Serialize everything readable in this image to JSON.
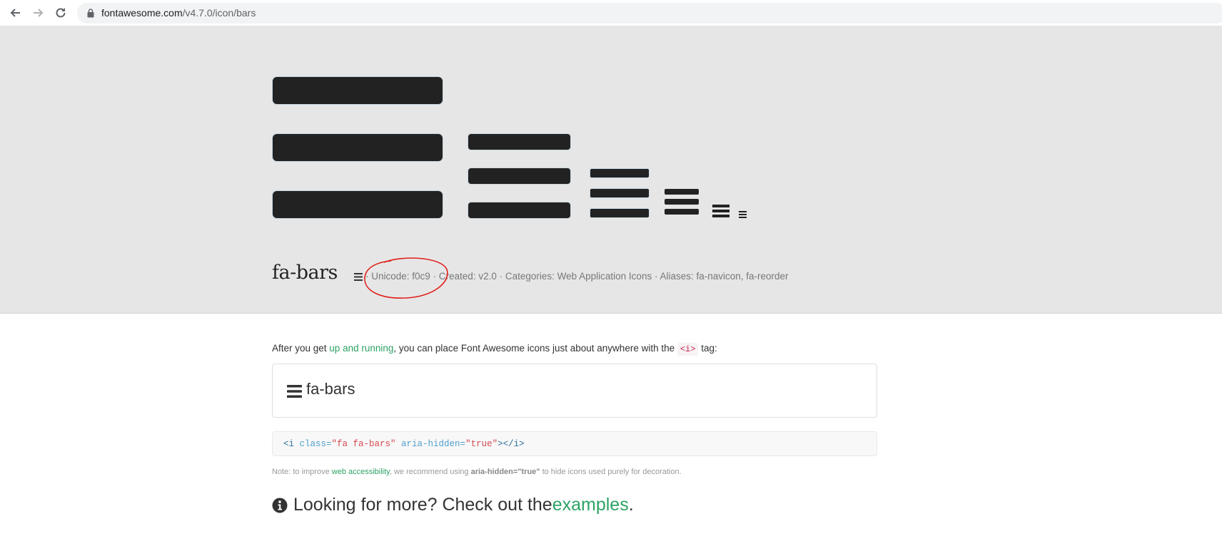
{
  "browser": {
    "url_host": "fontawesome.com",
    "url_path": "/v4.7.0/icon/bars",
    "icons": [
      "back-arrow-icon",
      "forward-arrow-icon",
      "reload-icon",
      "lock-icon"
    ]
  },
  "hero": {
    "title": "fa-bars",
    "meta": "· Unicode: f0c9 · Created: v2.0 · Categories: Web Application Icons · Aliases: fa-navicon, fa-reorder",
    "icon": "bars-icon",
    "annotation_color": "#e0201c"
  },
  "content": {
    "intro_before": "After you get ",
    "intro_link": "up and running",
    "intro_middle": ", you can place Font Awesome icons just about anywhere with the ",
    "intro_code": "<i>",
    "intro_after": " tag:",
    "example_label": "fa-bars",
    "code_parts": {
      "open": "<i ",
      "class_attr": "class=",
      "class_val": "\"fa fa-bars\"",
      "aria_attr": " aria-hidden=",
      "aria_val": "\"true\"",
      "close": "></i>"
    },
    "note_before": "Note: to improve ",
    "note_link": "web accessibility",
    "note_middle": ", we recommend using ",
    "note_bold": "aria-hidden=\"true\"",
    "note_after": " to hide icons used purely for decoration.",
    "more_text": "Looking for more? Check out the ",
    "more_link": "examples",
    "more_end": "."
  },
  "colors": {
    "accent": "#2da365",
    "hero_bg": "#e6e6e6",
    "icon": "#222222"
  }
}
